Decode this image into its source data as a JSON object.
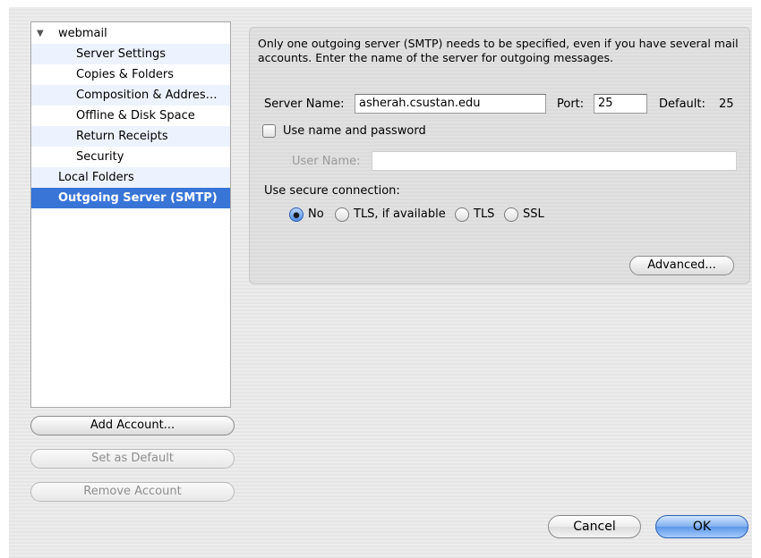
{
  "tree": {
    "account": "webmail",
    "items": [
      {
        "label": "Server Settings"
      },
      {
        "label": "Copies & Folders"
      },
      {
        "label": "Composition & Addres…"
      },
      {
        "label": "Offline & Disk Space"
      },
      {
        "label": "Return Receipts"
      },
      {
        "label": "Security"
      }
    ],
    "local_folders": "Local Folders",
    "outgoing": "Outgoing Server (SMTP)"
  },
  "account_buttons": {
    "add": "Add Account...",
    "set_default": "Set as Default",
    "remove": "Remove Account"
  },
  "smtp": {
    "description": "Only one outgoing server (SMTP) needs to be specified, even if you have several mail accounts. Enter the name of the server for outgoing messages.",
    "server_name_label": "Server Name:",
    "server_name_value": "asherah.csustan.edu",
    "port_label": "Port:",
    "port_value": "25",
    "default_label": "Default:",
    "default_value": "25",
    "use_auth_label": "Use name and password",
    "use_auth_checked": false,
    "user_name_label": "User Name:",
    "user_name_value": "",
    "secure_label": "Use secure connection:",
    "secure_options": [
      "No",
      "TLS, if available",
      "TLS",
      "SSL"
    ],
    "secure_selected": "No",
    "advanced_button": "Advanced..."
  },
  "dialog": {
    "cancel": "Cancel",
    "ok": "OK"
  }
}
